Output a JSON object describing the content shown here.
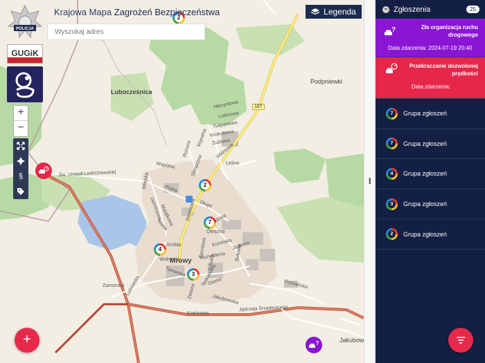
{
  "header": {
    "title_light": "Krajowa Mapa ",
    "title_bold": "Zagrożeń Bezpieczeństwa",
    "search_placeholder": "Wyszukaj adres",
    "legend_label": "Legenda"
  },
  "logos": {
    "policja": "POLICJA",
    "gugik": "GUGiK"
  },
  "map_controls": {
    "zoom_in": "+",
    "zoom_out": "−",
    "tools": [
      "fullscreen-icon",
      "locate-icon",
      "paragraph-icon",
      "tags-icon"
    ],
    "paragraph_glyph": "§"
  },
  "map_labels": {
    "places": [
      "Lubocześnica",
      "Podpniewki",
      "Jakubowo"
    ],
    "town": "Mrowy",
    "road_number": "187",
    "streets": [
      "Hiacyntowa",
      "Lubinowa",
      "Tulipanowa",
      "Krokusowa",
      "Żużlowa",
      "Leśna",
      "Wiśniowa",
      "Polna",
      "Słoneczna",
      "Rożana",
      "Wypalna",
      "Wspólna",
      "Wiejska",
      "Jaśminowa",
      "Nowa",
      "Długa",
      "Dworcowa",
      "Grobla",
      "Wolności",
      "Okrężna",
      "Ogrodowa",
      "Konińska",
      "Wyzwolenia",
      "Bukowa",
      "Jodłowa",
      "Zamorska",
      "Turowska",
      "Lubowska",
      "Spacerowa",
      "Szkolna",
      "Dasna",
      "Zielona",
      "Jakubowska",
      "Poznańska",
      "Krańcowa",
      "Jędrzeja Śniadeckiego",
      "Św. Urszuli Ledóchowskiej",
      "Majątkowa",
      "Sportowa"
    ]
  },
  "markers": [
    "2",
    "7",
    "4",
    "3",
    "2"
  ],
  "sidebar": {
    "title": "Zgłoszenia",
    "count": "25",
    "cards": [
      {
        "title": "Zła organizacja ruchu drogowego",
        "date": "Data zdarzenia: 2024-07-19 20:40"
      },
      {
        "title": "Przekraczanie dozwolonej prędkości",
        "date": "Data zdarzenia:"
      }
    ],
    "groups": [
      {
        "count": "7",
        "label": "Grupa zgłoszeń"
      },
      {
        "count": "7",
        "label": "Grupa zgłoszeń"
      },
      {
        "count": "4",
        "label": "Grupa zgłoszeń"
      },
      {
        "count": "3",
        "label": "Grupa zgłoszeń"
      },
      {
        "count": "2",
        "label": "Grupa zgłoszeń"
      }
    ]
  },
  "buttons": {
    "add": "+"
  },
  "colors": {
    "panel_bg": "#142043",
    "violet": "#8a16d3",
    "red": "#e6264a",
    "accent_button": "#e72a4c"
  }
}
